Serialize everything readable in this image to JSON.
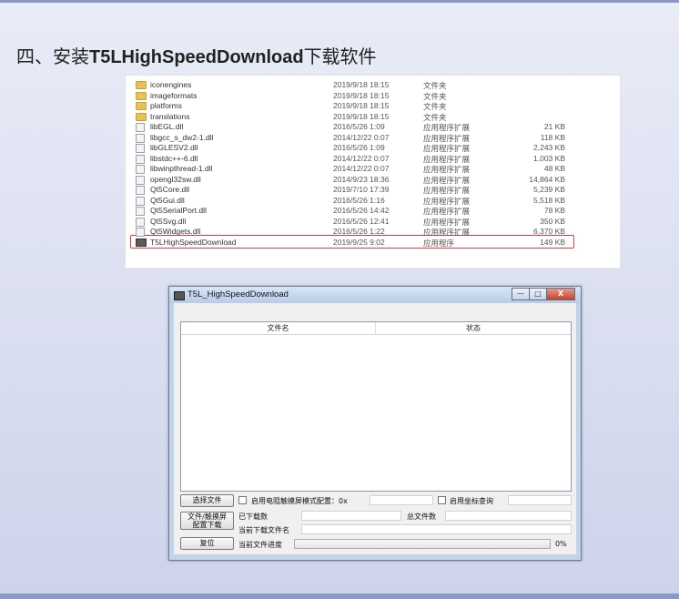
{
  "slide": {
    "title_prefix": "四、安装",
    "title_app": "T5LHighSpeedDownload",
    "title_suffix": "下载软件"
  },
  "explorer": {
    "files": [
      {
        "name": "iconengines",
        "date": "2019/9/18 18:15",
        "type": "文件夹",
        "size": "",
        "icon": "folder-icon"
      },
      {
        "name": "imageformats",
        "date": "2019/9/18 18:15",
        "type": "文件夹",
        "size": "",
        "icon": "folder-icon"
      },
      {
        "name": "platforms",
        "date": "2019/9/18 18:15",
        "type": "文件夹",
        "size": "",
        "icon": "folder-icon"
      },
      {
        "name": "translations",
        "date": "2019/9/18 18:15",
        "type": "文件夹",
        "size": "",
        "icon": "folder-icon"
      },
      {
        "name": "libEGL.dll",
        "date": "2016/5/26 1:09",
        "type": "应用程序扩展",
        "size": "21 KB",
        "icon": "dll-file-icon"
      },
      {
        "name": "libgcc_s_dw2-1.dll",
        "date": "2014/12/22 0:07",
        "type": "应用程序扩展",
        "size": "118 KB",
        "icon": "dll-file-icon"
      },
      {
        "name": "libGLESV2.dll",
        "date": "2016/5/26 1:09",
        "type": "应用程序扩展",
        "size": "2,243 KB",
        "icon": "dll-file-icon"
      },
      {
        "name": "libstdc++-6.dll",
        "date": "2014/12/22 0:07",
        "type": "应用程序扩展",
        "size": "1,003 KB",
        "icon": "dll-file-icon"
      },
      {
        "name": "libwinpthread-1.dll",
        "date": "2014/12/22 0:07",
        "type": "应用程序扩展",
        "size": "48 KB",
        "icon": "dll-file-icon"
      },
      {
        "name": "opengl32sw.dll",
        "date": "2014/9/23 18:36",
        "type": "应用程序扩展",
        "size": "14,864 KB",
        "icon": "dll-file-icon"
      },
      {
        "name": "Qt5Core.dll",
        "date": "2019/7/10 17:39",
        "type": "应用程序扩展",
        "size": "5,239 KB",
        "icon": "dll-file-icon"
      },
      {
        "name": "Qt5Gui.dll",
        "date": "2016/5/26 1:16",
        "type": "应用程序扩展",
        "size": "5,518 KB",
        "icon": "dll-file-icon"
      },
      {
        "name": "Qt5SerialPort.dll",
        "date": "2016/5/26 14:42",
        "type": "应用程序扩展",
        "size": "78 KB",
        "icon": "dll-file-icon"
      },
      {
        "name": "Qt5Svg.dll",
        "date": "2016/5/26 12:41",
        "type": "应用程序扩展",
        "size": "350 KB",
        "icon": "dll-file-icon"
      },
      {
        "name": "Qt5Widgets.dll",
        "date": "2016/5/26 1:22",
        "type": "应用程序扩展",
        "size": "6,370 KB",
        "icon": "dll-file-icon"
      },
      {
        "name": "T5LHighSpeedDownload",
        "date": "2019/9/25 9:02",
        "type": "应用程序",
        "size": "149 KB",
        "icon": "exe-file-icon"
      }
    ]
  },
  "window": {
    "title": "T5L_HighSpeedDownload",
    "controls": {
      "minimize": "—",
      "maximize": "□",
      "close": "X"
    },
    "list_headers": {
      "file_name": "文件名",
      "status": "状态"
    },
    "select_file_button": "选择文件",
    "touch_config_button_line1": "文件/触摸屏",
    "touch_config_button_line2": "配置下载",
    "reset_button": "复位",
    "resistive_checkbox_label": "启用电阻触摸屏模式配置：0x",
    "coordinate_checkbox_label": "启用坐标查询",
    "downloaded_count_label": "已下载数",
    "total_files_label": "总文件数",
    "current_file_name_label": "当前下载文件名",
    "current_progress_label": "当前文件进度",
    "progress_percent": "0%",
    "progress_value": 0
  }
}
